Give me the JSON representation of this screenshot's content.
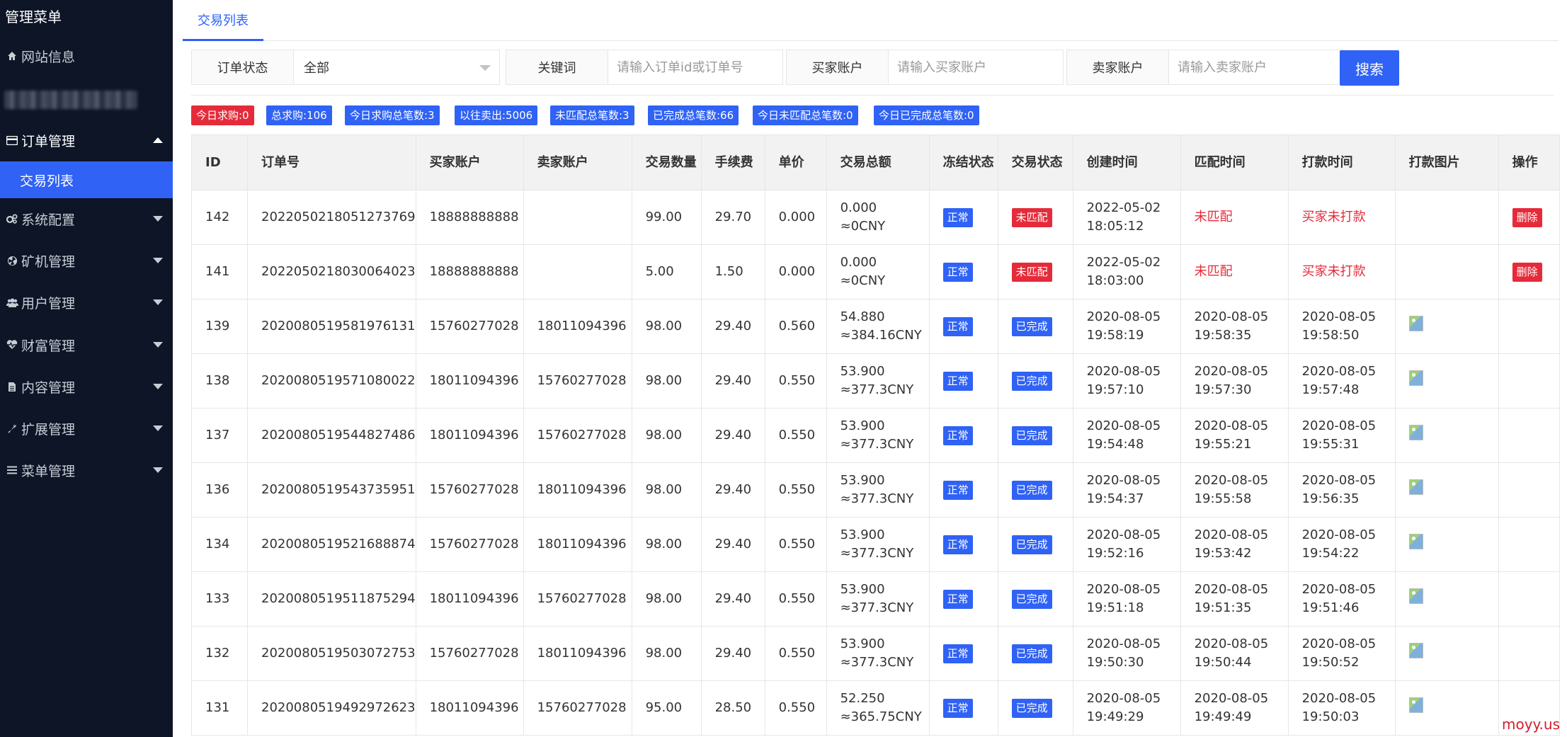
{
  "sidebar": {
    "title": "管理菜单",
    "items": [
      {
        "label": "网站信息",
        "icon": "home-icon"
      },
      {
        "label": "订单管理",
        "icon": "card-icon"
      },
      {
        "label": "系统配置",
        "icon": "gears-icon"
      },
      {
        "label": "矿机管理",
        "icon": "fan-icon"
      },
      {
        "label": "用户管理",
        "icon": "users-icon"
      },
      {
        "label": "财富管理",
        "icon": "heartbeat-icon"
      },
      {
        "label": "内容管理",
        "icon": "document-icon"
      },
      {
        "label": "扩展管理",
        "icon": "wrench-icon"
      },
      {
        "label": "菜单管理",
        "icon": "list-icon"
      }
    ],
    "sub_item": "交易列表"
  },
  "tab": {
    "label": "交易列表"
  },
  "filters": {
    "status_label": "订单状态",
    "status_value": "全部",
    "keyword_label": "关键词",
    "keyword_placeholder": "请输入订单id或订单号",
    "buyer_label": "买家账户",
    "buyer_placeholder": "请输入买家账户",
    "seller_label": "卖家账户",
    "seller_placeholder": "请输入卖家账户",
    "search_label": "搜索"
  },
  "stats": [
    {
      "text": "今日求购:0",
      "color": "#e52b3a"
    },
    {
      "text": "总求购:106",
      "color": "#2f62f5"
    },
    {
      "text": "今日求购总笔数:3",
      "color": "#2f62f5"
    },
    {
      "text": "以往卖出:5006",
      "color": "#2f62f5"
    },
    {
      "text": "未匹配总笔数:3",
      "color": "#2f62f5"
    },
    {
      "text": "已完成总笔数:66",
      "color": "#2f62f5"
    },
    {
      "text": "今日未匹配总笔数:0",
      "color": "#2f62f5"
    },
    {
      "text": "今日已完成总笔数:0",
      "color": "#2f62f5"
    }
  ],
  "table": {
    "headers": [
      "ID",
      "订单号",
      "买家账户",
      "卖家账户",
      "交易数量",
      "手续费",
      "单价",
      "交易总额",
      "冻结状态",
      "交易状态",
      "创建时间",
      "匹配时间",
      "打款时间",
      "打款图片",
      "操作"
    ],
    "rows": [
      {
        "id": "142",
        "order": "2022050218051273769",
        "buyer": "18888888888",
        "seller": "",
        "qty": "99.00",
        "fee": "29.70",
        "price": "0.000",
        "total1": "0.000",
        "total2": "≈0CNY",
        "freeze": "正常",
        "status": "未匹配",
        "created1": "2022-05-02",
        "created2": "18:05:12",
        "matched1": "未匹配",
        "matched2": "",
        "paid1": "买家未打款",
        "paid2": "",
        "has_image": false,
        "action": "删除"
      },
      {
        "id": "141",
        "order": "2022050218030064023",
        "buyer": "18888888888",
        "seller": "",
        "qty": "5.00",
        "fee": "1.50",
        "price": "0.000",
        "total1": "0.000",
        "total2": "≈0CNY",
        "freeze": "正常",
        "status": "未匹配",
        "created1": "2022-05-02",
        "created2": "18:03:00",
        "matched1": "未匹配",
        "matched2": "",
        "paid1": "买家未打款",
        "paid2": "",
        "has_image": false,
        "action": "删除"
      },
      {
        "id": "139",
        "order": "2020080519581976131",
        "buyer": "15760277028",
        "seller": "18011094396",
        "qty": "98.00",
        "fee": "29.40",
        "price": "0.560",
        "total1": "54.880",
        "total2": "≈384.16CNY",
        "freeze": "正常",
        "status": "已完成",
        "created1": "2020-08-05",
        "created2": "19:58:19",
        "matched1": "2020-08-05",
        "matched2": "19:58:35",
        "paid1": "2020-08-05",
        "paid2": "19:58:50",
        "has_image": true,
        "action": ""
      },
      {
        "id": "138",
        "order": "2020080519571080022",
        "buyer": "18011094396",
        "seller": "15760277028",
        "qty": "98.00",
        "fee": "29.40",
        "price": "0.550",
        "total1": "53.900",
        "total2": "≈377.3CNY",
        "freeze": "正常",
        "status": "已完成",
        "created1": "2020-08-05",
        "created2": "19:57:10",
        "matched1": "2020-08-05",
        "matched2": "19:57:30",
        "paid1": "2020-08-05",
        "paid2": "19:57:48",
        "has_image": true,
        "action": ""
      },
      {
        "id": "137",
        "order": "2020080519544827486",
        "buyer": "18011094396",
        "seller": "15760277028",
        "qty": "98.00",
        "fee": "29.40",
        "price": "0.550",
        "total1": "53.900",
        "total2": "≈377.3CNY",
        "freeze": "正常",
        "status": "已完成",
        "created1": "2020-08-05",
        "created2": "19:54:48",
        "matched1": "2020-08-05",
        "matched2": "19:55:21",
        "paid1": "2020-08-05",
        "paid2": "19:55:31",
        "has_image": true,
        "action": ""
      },
      {
        "id": "136",
        "order": "2020080519543735951",
        "buyer": "15760277028",
        "seller": "18011094396",
        "qty": "98.00",
        "fee": "29.40",
        "price": "0.550",
        "total1": "53.900",
        "total2": "≈377.3CNY",
        "freeze": "正常",
        "status": "已完成",
        "created1": "2020-08-05",
        "created2": "19:54:37",
        "matched1": "2020-08-05",
        "matched2": "19:55:58",
        "paid1": "2020-08-05",
        "paid2": "19:56:35",
        "has_image": true,
        "action": ""
      },
      {
        "id": "134",
        "order": "2020080519521688874",
        "buyer": "15760277028",
        "seller": "18011094396",
        "qty": "98.00",
        "fee": "29.40",
        "price": "0.550",
        "total1": "53.900",
        "total2": "≈377.3CNY",
        "freeze": "正常",
        "status": "已完成",
        "created1": "2020-08-05",
        "created2": "19:52:16",
        "matched1": "2020-08-05",
        "matched2": "19:53:42",
        "paid1": "2020-08-05",
        "paid2": "19:54:22",
        "has_image": true,
        "action": ""
      },
      {
        "id": "133",
        "order": "2020080519511875294",
        "buyer": "18011094396",
        "seller": "15760277028",
        "qty": "98.00",
        "fee": "29.40",
        "price": "0.550",
        "total1": "53.900",
        "total2": "≈377.3CNY",
        "freeze": "正常",
        "status": "已完成",
        "created1": "2020-08-05",
        "created2": "19:51:18",
        "matched1": "2020-08-05",
        "matched2": "19:51:35",
        "paid1": "2020-08-05",
        "paid2": "19:51:46",
        "has_image": true,
        "action": ""
      },
      {
        "id": "132",
        "order": "2020080519503072753",
        "buyer": "15760277028",
        "seller": "18011094396",
        "qty": "98.00",
        "fee": "29.40",
        "price": "0.550",
        "total1": "53.900",
        "total2": "≈377.3CNY",
        "freeze": "正常",
        "status": "已完成",
        "created1": "2020-08-05",
        "created2": "19:50:30",
        "matched1": "2020-08-05",
        "matched2": "19:50:44",
        "paid1": "2020-08-05",
        "paid2": "19:50:52",
        "has_image": true,
        "action": ""
      },
      {
        "id": "131",
        "order": "2020080519492972623",
        "buyer": "18011094396",
        "seller": "15760277028",
        "qty": "95.00",
        "fee": "28.50",
        "price": "0.550",
        "total1": "52.250",
        "total2": "≈365.75CNY",
        "freeze": "正常",
        "status": "已完成",
        "created1": "2020-08-05",
        "created2": "19:49:29",
        "matched1": "2020-08-05",
        "matched2": "19:49:49",
        "paid1": "2020-08-05",
        "paid2": "19:50:03",
        "has_image": true,
        "action": ""
      }
    ]
  },
  "watermark": "moyy.us"
}
